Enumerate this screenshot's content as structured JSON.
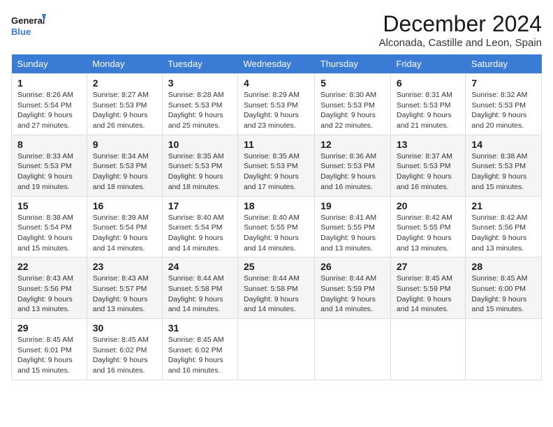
{
  "header": {
    "logo_line1": "General",
    "logo_line2": "Blue",
    "title": "December 2024",
    "subtitle": "Alconada, Castille and Leon, Spain"
  },
  "columns": [
    "Sunday",
    "Monday",
    "Tuesday",
    "Wednesday",
    "Thursday",
    "Friday",
    "Saturday"
  ],
  "weeks": [
    [
      {
        "day": "1",
        "info": "Sunrise: 8:26 AM\nSunset: 5:54 PM\nDaylight: 9 hours and 27 minutes."
      },
      {
        "day": "2",
        "info": "Sunrise: 8:27 AM\nSunset: 5:53 PM\nDaylight: 9 hours and 26 minutes."
      },
      {
        "day": "3",
        "info": "Sunrise: 8:28 AM\nSunset: 5:53 PM\nDaylight: 9 hours and 25 minutes."
      },
      {
        "day": "4",
        "info": "Sunrise: 8:29 AM\nSunset: 5:53 PM\nDaylight: 9 hours and 23 minutes."
      },
      {
        "day": "5",
        "info": "Sunrise: 8:30 AM\nSunset: 5:53 PM\nDaylight: 9 hours and 22 minutes."
      },
      {
        "day": "6",
        "info": "Sunrise: 8:31 AM\nSunset: 5:53 PM\nDaylight: 9 hours and 21 minutes."
      },
      {
        "day": "7",
        "info": "Sunrise: 8:32 AM\nSunset: 5:53 PM\nDaylight: 9 hours and 20 minutes."
      }
    ],
    [
      {
        "day": "8",
        "info": "Sunrise: 8:33 AM\nSunset: 5:53 PM\nDaylight: 9 hours and 19 minutes."
      },
      {
        "day": "9",
        "info": "Sunrise: 8:34 AM\nSunset: 5:53 PM\nDaylight: 9 hours and 18 minutes."
      },
      {
        "day": "10",
        "info": "Sunrise: 8:35 AM\nSunset: 5:53 PM\nDaylight: 9 hours and 18 minutes."
      },
      {
        "day": "11",
        "info": "Sunrise: 8:35 AM\nSunset: 5:53 PM\nDaylight: 9 hours and 17 minutes."
      },
      {
        "day": "12",
        "info": "Sunrise: 8:36 AM\nSunset: 5:53 PM\nDaylight: 9 hours and 16 minutes."
      },
      {
        "day": "13",
        "info": "Sunrise: 8:37 AM\nSunset: 5:53 PM\nDaylight: 9 hours and 16 minutes."
      },
      {
        "day": "14",
        "info": "Sunrise: 8:38 AM\nSunset: 5:53 PM\nDaylight: 9 hours and 15 minutes."
      }
    ],
    [
      {
        "day": "15",
        "info": "Sunrise: 8:38 AM\nSunset: 5:54 PM\nDaylight: 9 hours and 15 minutes."
      },
      {
        "day": "16",
        "info": "Sunrise: 8:39 AM\nSunset: 5:54 PM\nDaylight: 9 hours and 14 minutes."
      },
      {
        "day": "17",
        "info": "Sunrise: 8:40 AM\nSunset: 5:54 PM\nDaylight: 9 hours and 14 minutes."
      },
      {
        "day": "18",
        "info": "Sunrise: 8:40 AM\nSunset: 5:55 PM\nDaylight: 9 hours and 14 minutes."
      },
      {
        "day": "19",
        "info": "Sunrise: 8:41 AM\nSunset: 5:55 PM\nDaylight: 9 hours and 13 minutes."
      },
      {
        "day": "20",
        "info": "Sunrise: 8:42 AM\nSunset: 5:55 PM\nDaylight: 9 hours and 13 minutes."
      },
      {
        "day": "21",
        "info": "Sunrise: 8:42 AM\nSunset: 5:56 PM\nDaylight: 9 hours and 13 minutes."
      }
    ],
    [
      {
        "day": "22",
        "info": "Sunrise: 8:43 AM\nSunset: 5:56 PM\nDaylight: 9 hours and 13 minutes."
      },
      {
        "day": "23",
        "info": "Sunrise: 8:43 AM\nSunset: 5:57 PM\nDaylight: 9 hours and 13 minutes."
      },
      {
        "day": "24",
        "info": "Sunrise: 8:44 AM\nSunset: 5:58 PM\nDaylight: 9 hours and 14 minutes."
      },
      {
        "day": "25",
        "info": "Sunrise: 8:44 AM\nSunset: 5:58 PM\nDaylight: 9 hours and 14 minutes."
      },
      {
        "day": "26",
        "info": "Sunrise: 8:44 AM\nSunset: 5:59 PM\nDaylight: 9 hours and 14 minutes."
      },
      {
        "day": "27",
        "info": "Sunrise: 8:45 AM\nSunset: 5:59 PM\nDaylight: 9 hours and 14 minutes."
      },
      {
        "day": "28",
        "info": "Sunrise: 8:45 AM\nSunset: 6:00 PM\nDaylight: 9 hours and 15 minutes."
      }
    ],
    [
      {
        "day": "29",
        "info": "Sunrise: 8:45 AM\nSunset: 6:01 PM\nDaylight: 9 hours and 15 minutes."
      },
      {
        "day": "30",
        "info": "Sunrise: 8:45 AM\nSunset: 6:02 PM\nDaylight: 9 hours and 16 minutes."
      },
      {
        "day": "31",
        "info": "Sunrise: 8:45 AM\nSunset: 6:02 PM\nDaylight: 9 hours and 16 minutes."
      },
      null,
      null,
      null,
      null
    ]
  ]
}
